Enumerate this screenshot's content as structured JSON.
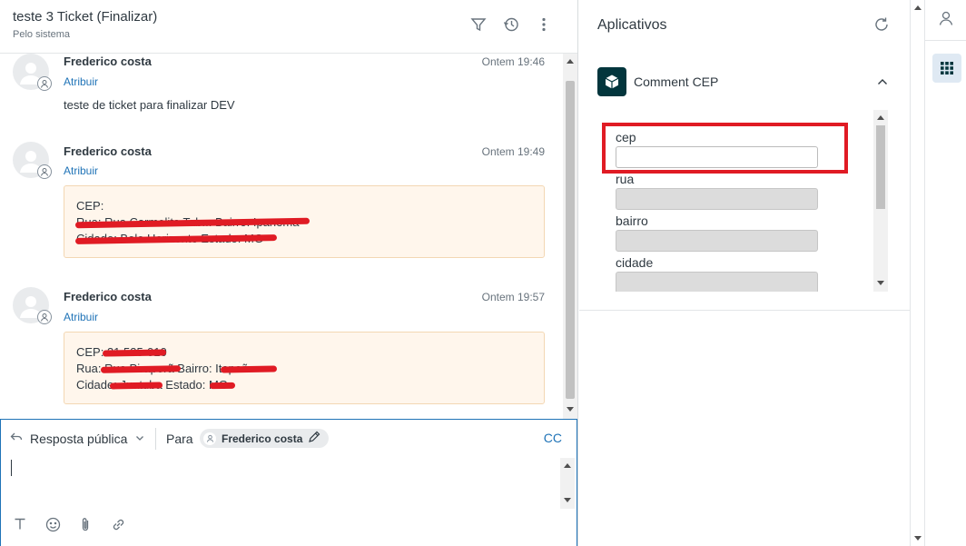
{
  "ticket": {
    "title": "teste 3 Ticket (Finalizar)",
    "subtitle": "Pelo sistema"
  },
  "header_icons": [
    "filter-icon",
    "history-icon",
    "more-vertical-icon"
  ],
  "messages": [
    {
      "author": "Frederico costa",
      "assign": "Atribuir",
      "time": "Ontem 19:46",
      "text": "teste de ticket para finalizar DEV"
    },
    {
      "author": "Frederico costa",
      "assign": "Atribuir",
      "time": "Ontem 19:49",
      "note_lines": [
        "CEP:",
        "Rua: Rua Carmelita Tab... Bairro: Ipanema",
        "Cidade: Belo Horizonte Estado: MG"
      ]
    },
    {
      "author": "Frederico costa",
      "assign": "Atribuir",
      "time": "Ontem 19:57",
      "note_lines": [
        "CEP: 31.535-010",
        "Rua: Rua Piraporã Bairro: Itapoã",
        "Cidade: Juatuba Estado: MG"
      ]
    }
  ],
  "composer": {
    "reply_type": "Resposta pública",
    "to_label": "Para",
    "recipient": "Frederico costa",
    "cc": "CC",
    "tools": [
      "text-format-icon",
      "emoji-icon",
      "attachment-icon",
      "link-icon"
    ]
  },
  "apps": {
    "title": "Aplicativos",
    "app_name": "Comment CEP",
    "fields": [
      {
        "label": "cep",
        "value": "",
        "editable": true
      },
      {
        "label": "rua",
        "value": "",
        "editable": false
      },
      {
        "label": "bairro",
        "value": "",
        "editable": false
      },
      {
        "label": "cidade",
        "value": "",
        "editable": false
      }
    ]
  },
  "colors": {
    "link": "#1f73b7",
    "note_bg": "#fff6ec",
    "note_border": "#f3d7b3",
    "redaction": "#e01b24",
    "app_logo_bg": "#03363d",
    "rail_active_bg": "#dfe9f3"
  }
}
